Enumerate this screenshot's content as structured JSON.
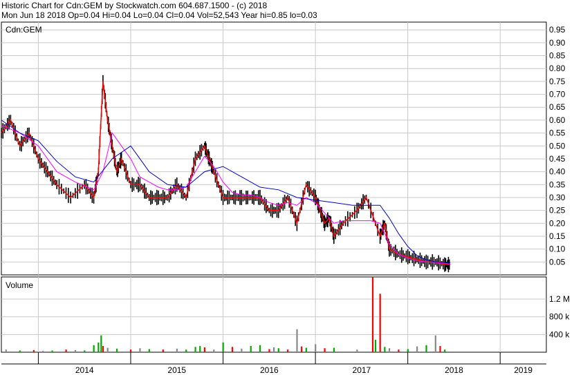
{
  "header": {
    "line1": "Historic Chart for Cdn:GEM by Stockwatch.com 604.687.1500 - (c) 2018",
    "line2": "Mon Jun 18 2018  Op=0.04  Hi=0.04  Lo=0.04  Cl=0.04  Vol=52,543  Year hi=0.85  lo=0.03"
  },
  "chart_data": [
    {
      "type": "line",
      "title": "Cdn:GEM",
      "y_ticks": [
        "0.95",
        "0.90",
        "0.85",
        "0.80",
        "0.75",
        "0.70",
        "0.65",
        "0.60",
        "0.55",
        "0.50",
        "0.45",
        "0.40",
        "0.35",
        "0.30",
        "0.25",
        "0.20",
        "0.15",
        "0.10",
        "0.05"
      ],
      "ylim": [
        0.0,
        0.98
      ],
      "x_ticks": [
        "2014",
        "2015",
        "2016",
        "2017",
        "2018",
        "2019"
      ],
      "x_range": [
        2013.6,
        2019.5
      ],
      "grid": true,
      "series": [
        {
          "role": "price",
          "color": "#ff0000",
          "x": [
            2013.6,
            2013.7,
            2013.8,
            2013.9,
            2014.0,
            2014.1,
            2014.2,
            2014.35,
            2014.5,
            2014.6,
            2014.65,
            2014.7,
            2014.75,
            2014.8,
            2014.85,
            2014.9,
            2015.0,
            2015.1,
            2015.2,
            2015.3,
            2015.4,
            2015.5,
            2015.6,
            2015.7,
            2015.8,
            2015.85,
            2015.9,
            2016.0,
            2016.1,
            2016.2,
            2016.3,
            2016.4,
            2016.5,
            2016.6,
            2016.7,
            2016.8,
            2016.9,
            2017.0,
            2017.05,
            2017.1,
            2017.15,
            2017.2,
            2017.3,
            2017.45,
            2017.55,
            2017.7,
            2017.75,
            2017.8,
            2017.9,
            2018.0,
            2018.1,
            2018.2,
            2018.3,
            2018.4,
            2018.46
          ],
          "y": [
            0.55,
            0.6,
            0.5,
            0.55,
            0.45,
            0.4,
            0.35,
            0.3,
            0.35,
            0.3,
            0.4,
            0.75,
            0.6,
            0.5,
            0.4,
            0.45,
            0.35,
            0.35,
            0.3,
            0.3,
            0.3,
            0.35,
            0.3,
            0.45,
            0.5,
            0.45,
            0.4,
            0.3,
            0.3,
            0.3,
            0.3,
            0.3,
            0.25,
            0.25,
            0.3,
            0.2,
            0.35,
            0.3,
            0.25,
            0.2,
            0.22,
            0.15,
            0.2,
            0.25,
            0.3,
            0.15,
            0.2,
            0.1,
            0.08,
            0.07,
            0.06,
            0.05,
            0.05,
            0.04,
            0.04
          ]
        },
        {
          "role": "moving-average-short",
          "color": "#ff00ff",
          "x": [
            2013.6,
            2013.8,
            2014.0,
            2014.2,
            2014.4,
            2014.6,
            2014.7,
            2014.8,
            2014.9,
            2015.0,
            2015.1,
            2015.2,
            2015.3,
            2015.4,
            2015.5,
            2015.6,
            2015.7,
            2015.8,
            2015.9,
            2016.0,
            2016.1,
            2016.2,
            2016.3,
            2016.4,
            2016.5,
            2016.6,
            2016.7,
            2016.8,
            2016.9,
            2017.0,
            2017.1,
            2017.2,
            2017.3,
            2017.4,
            2017.5,
            2017.6,
            2017.7,
            2017.8,
            2017.9,
            2018.0,
            2018.1,
            2018.2,
            2018.3,
            2018.4,
            2018.46
          ],
          "y": [
            0.58,
            0.55,
            0.5,
            0.4,
            0.36,
            0.33,
            0.4,
            0.55,
            0.5,
            0.45,
            0.38,
            0.36,
            0.34,
            0.33,
            0.33,
            0.34,
            0.4,
            0.46,
            0.42,
            0.36,
            0.32,
            0.31,
            0.31,
            0.3,
            0.28,
            0.27,
            0.28,
            0.27,
            0.3,
            0.28,
            0.24,
            0.2,
            0.21,
            0.21,
            0.21,
            0.21,
            0.2,
            0.12,
            0.08,
            0.065,
            0.055,
            0.05,
            0.048,
            0.045,
            0.042
          ]
        },
        {
          "role": "moving-average-long",
          "color": "#0000cc",
          "x": [
            2013.6,
            2013.8,
            2014.0,
            2014.2,
            2014.4,
            2014.6,
            2014.8,
            2015.0,
            2015.2,
            2015.4,
            2015.6,
            2015.8,
            2016.0,
            2016.2,
            2016.4,
            2016.6,
            2016.8,
            2017.0,
            2017.2,
            2017.4,
            2017.6,
            2017.7,
            2017.8,
            2017.9,
            2018.0,
            2018.1,
            2018.2,
            2018.3,
            2018.4,
            2018.46
          ],
          "y": [
            0.6,
            0.55,
            0.52,
            0.44,
            0.38,
            0.36,
            0.45,
            0.5,
            0.4,
            0.35,
            0.34,
            0.4,
            0.42,
            0.38,
            0.34,
            0.33,
            0.3,
            0.29,
            0.28,
            0.27,
            0.27,
            0.27,
            0.22,
            0.16,
            0.11,
            0.075,
            0.058,
            0.05,
            0.048,
            0.047
          ]
        }
      ]
    },
    {
      "type": "bar",
      "title": "Volume",
      "y_ticks": [
        "1.2 M",
        "800 k",
        "400 k"
      ],
      "ylim": [
        0,
        1700000
      ],
      "x_range": [
        2013.6,
        2019.5
      ],
      "grid": true,
      "series": [
        {
          "name": "",
          "color_up": "#00aa00",
          "color_down": "#ff0000",
          "color_flat": "#888888",
          "x": [
            2013.65,
            2013.8,
            2013.95,
            2014.05,
            2014.15,
            2014.3,
            2014.4,
            2014.5,
            2014.6,
            2014.65,
            2014.68,
            2014.7,
            2014.75,
            2014.85,
            2015.0,
            2015.1,
            2015.2,
            2015.35,
            2015.5,
            2015.6,
            2015.7,
            2015.75,
            2015.8,
            2015.9,
            2016.0,
            2016.1,
            2016.2,
            2016.3,
            2016.4,
            2016.5,
            2016.55,
            2016.6,
            2016.7,
            2016.8,
            2016.85,
            2016.9,
            2017.0,
            2017.1,
            2017.2,
            2017.45,
            2017.62,
            2017.65,
            2017.7,
            2017.75,
            2017.8,
            2017.9,
            2018.0,
            2018.1,
            2018.2,
            2018.3,
            2018.35,
            2018.4
          ],
          "values": [
            60000,
            40000,
            50000,
            30000,
            40000,
            60000,
            50000,
            40000,
            160000,
            220000,
            380000,
            140000,
            100000,
            80000,
            60000,
            90000,
            70000,
            60000,
            80000,
            60000,
            120000,
            140000,
            110000,
            60000,
            220000,
            120000,
            80000,
            140000,
            160000,
            70000,
            110000,
            90000,
            60000,
            520000,
            130000,
            100000,
            180000,
            90000,
            100000,
            60000,
            1700000,
            280000,
            1320000,
            120000,
            90000,
            60000,
            70000,
            130000,
            160000,
            380000,
            140000,
            60000
          ],
          "direction": [
            "flat",
            "up",
            "down",
            "flat",
            "up",
            "down",
            "flat",
            "up",
            "up",
            "up",
            "up",
            "down",
            "flat",
            "up",
            "down",
            "flat",
            "up",
            "down",
            "flat",
            "up",
            "up",
            "up",
            "down",
            "flat",
            "up",
            "down",
            "flat",
            "up",
            "up",
            "down",
            "flat",
            "up",
            "down",
            "flat",
            "down",
            "up",
            "flat",
            "down",
            "up",
            "flat",
            "down",
            "up",
            "down",
            "up",
            "flat",
            "down",
            "up",
            "flat",
            "up",
            "flat",
            "down",
            "up"
          ]
        }
      ]
    }
  ]
}
